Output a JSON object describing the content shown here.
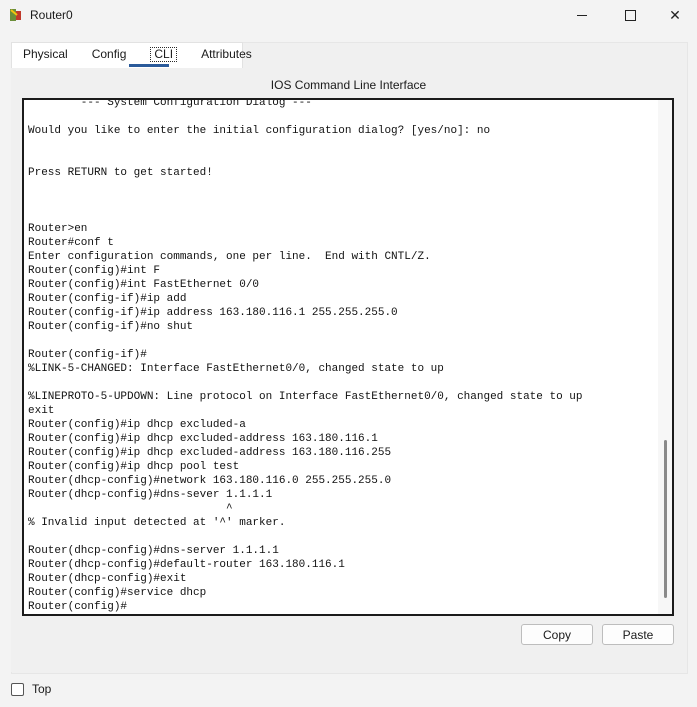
{
  "window": {
    "title": "Router0",
    "controls": {
      "minimize_icon": "minimize-icon",
      "maximize_icon": "maximize-icon",
      "close_glyph": "✕"
    }
  },
  "tabs": [
    {
      "label": "Physical",
      "active": false
    },
    {
      "label": "Config",
      "active": false
    },
    {
      "label": "CLI",
      "active": true
    },
    {
      "label": "Attributes",
      "active": false
    }
  ],
  "cli": {
    "heading": "IOS Command Line Interface",
    "lines": [
      "        --- System Configuration Dialog ---",
      "",
      "Would you like to enter the initial configuration dialog? [yes/no]: no",
      "",
      "",
      "Press RETURN to get started!",
      "",
      "",
      "",
      "Router>en",
      "Router#conf t",
      "Enter configuration commands, one per line.  End with CNTL/Z.",
      "Router(config)#int F",
      "Router(config)#int FastEthernet 0/0",
      "Router(config-if)#ip add",
      "Router(config-if)#ip address 163.180.116.1 255.255.255.0",
      "Router(config-if)#no shut",
      "",
      "Router(config-if)#",
      "%LINK-5-CHANGED: Interface FastEthernet0/0, changed state to up",
      "",
      "%LINEPROTO-5-UPDOWN: Line protocol on Interface FastEthernet0/0, changed state to up",
      "exit",
      "Router(config)#ip dhcp excluded-a",
      "Router(config)#ip dhcp excluded-address 163.180.116.1",
      "Router(config)#ip dhcp excluded-address 163.180.116.255",
      "Router(config)#ip dhcp pool test",
      "Router(dhcp-config)#network 163.180.116.0 255.255.255.0",
      "Router(dhcp-config)#dns-sever 1.1.1.1",
      "                              ^",
      "% Invalid input detected at '^' marker.",
      "",
      "Router(dhcp-config)#dns-server 1.1.1.1",
      "Router(dhcp-config)#default-router 163.180.116.1",
      "Router(dhcp-config)#exit",
      "Router(config)#service dhcp",
      "Router(config)#"
    ]
  },
  "buttons": {
    "copy": "Copy",
    "paste": "Paste"
  },
  "footer": {
    "top_label": "Top",
    "top_checked": false
  }
}
